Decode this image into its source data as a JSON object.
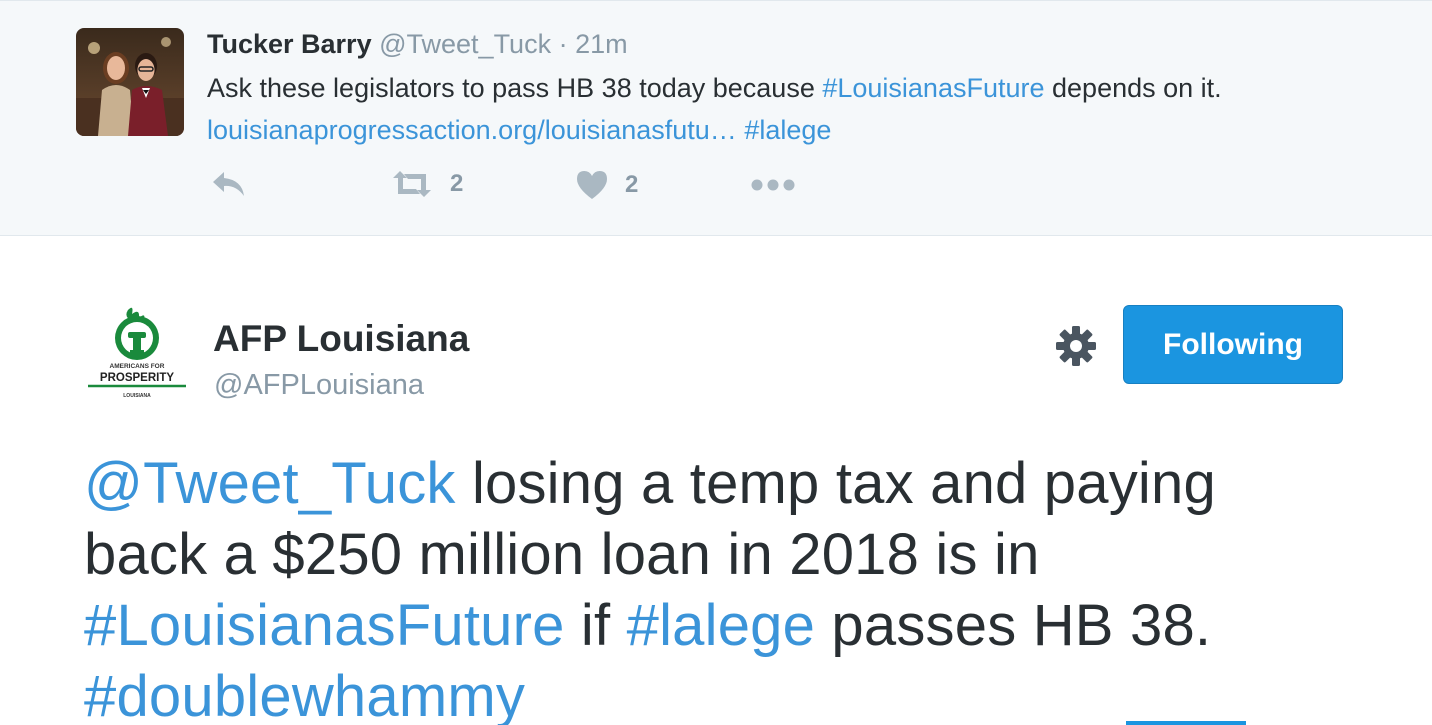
{
  "parent_tweet": {
    "author_name": "Tucker Barry",
    "author_handle": "@Tweet_Tuck",
    "separator": "·",
    "time": "21m",
    "text_parts": [
      {
        "text": "Ask these legislators to pass HB 38 today because ",
        "type": "text"
      },
      {
        "text": "#LouisianasFuture",
        "type": "hashtag"
      },
      {
        "text": " depends on it. ",
        "type": "text"
      },
      {
        "text": "louisianaprogressaction.org/louisianasfutu…",
        "type": "link"
      },
      {
        "text": " ",
        "type": "text"
      },
      {
        "text": "#lalege",
        "type": "hashtag"
      }
    ],
    "retweet_count": "2",
    "like_count": "2"
  },
  "main_tweet": {
    "author_name": "AFP Louisiana",
    "author_handle": "@AFPLouisiana",
    "follow_label": "Following",
    "avatar_logo": {
      "line1": "AMERICANS FOR",
      "line2": "PROSPERITY",
      "line3": "LOUISIANA"
    },
    "text_parts": [
      {
        "text": "@Tweet_Tuck",
        "type": "mention"
      },
      {
        "text": " losing a temp tax and paying back a $250 million loan in 2018 is in ",
        "type": "text"
      },
      {
        "text": "#LouisianasFuture",
        "type": "hashtag"
      },
      {
        "text": " if ",
        "type": "text"
      },
      {
        "text": "#lalege",
        "type": "hashtag"
      },
      {
        "text": " passes HB 38. ",
        "type": "text"
      },
      {
        "text": "#doublewhammy",
        "type": "hashtag"
      }
    ]
  },
  "icons": {
    "reply": "reply-icon",
    "retweet": "retweet-icon",
    "like": "heart-icon",
    "more": "more-dots-icon",
    "settings": "gear-icon"
  },
  "colors": {
    "link": "#3b94d9",
    "text": "#292f33",
    "muted": "#8899a6",
    "button": "#1b95e0",
    "parent_bg": "#f5f8fa",
    "afp_green": "#1a8a3c"
  }
}
